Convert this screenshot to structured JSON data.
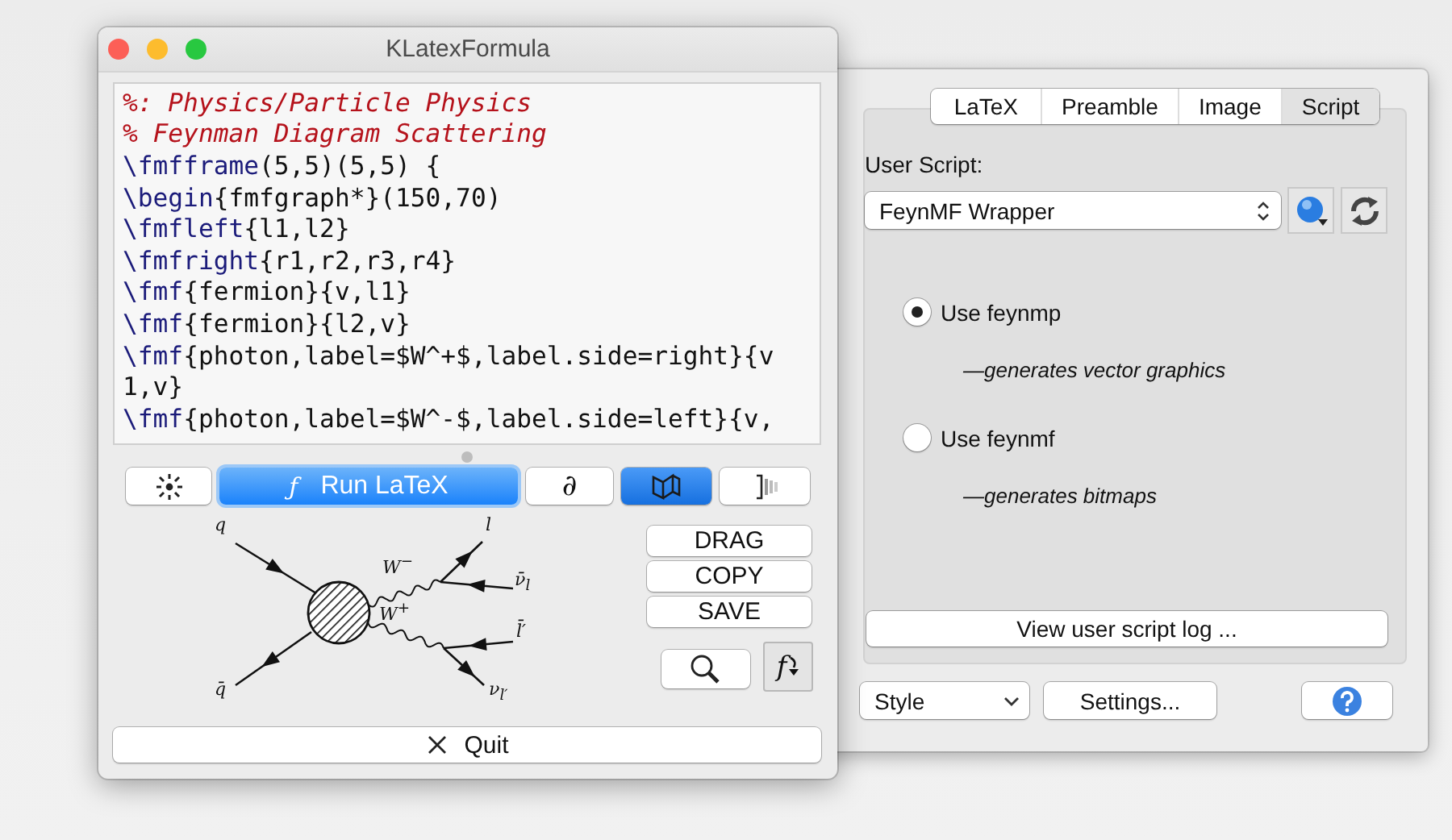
{
  "main_window": {
    "title": "KLatexFormula",
    "editor": {
      "lines": [
        {
          "kind": "comment",
          "text": "%: Physics/Particle Physics"
        },
        {
          "kind": "comment",
          "text": "% Feynman Diagram Scattering"
        },
        {
          "kind": "code",
          "command": "\\fmfframe",
          "rest": "(5,5)(5,5) {"
        },
        {
          "kind": "code",
          "command": "\\begin",
          "rest": "{fmfgraph*}(150,70)"
        },
        {
          "kind": "code",
          "command": "\\fmfleft",
          "rest": "{l1,l2}"
        },
        {
          "kind": "code",
          "command": "\\fmfright",
          "rest": "{r1,r2,r3,r4}"
        },
        {
          "kind": "code",
          "command": "\\fmf",
          "rest": "{fermion}{v,l1}"
        },
        {
          "kind": "code",
          "command": "\\fmf",
          "rest": "{fermion}{l2,v}"
        },
        {
          "kind": "code",
          "command": "\\fmf",
          "rest": "{photon,label=$W^+$,label.side=right}{v"
        },
        {
          "kind": "code",
          "rest": "1,v}"
        },
        {
          "kind": "code",
          "command": "\\fmf",
          "rest": "{photon,label=$W^-$,label.side=left}{v,"
        }
      ]
    },
    "toolbar": [
      {
        "kind": "icon",
        "pressed": false
      },
      {
        "kind": "primary",
        "icon_char": "ƒ",
        "label": "Run LaTeX",
        "pressed": false
      },
      {
        "kind": "glyph",
        "label": "∂",
        "pressed": false
      },
      {
        "kind": "icon",
        "pressed": true
      },
      {
        "kind": "icon",
        "pressed": false
      }
    ],
    "preview": {
      "labels": [
        "q",
        "l",
        "W$^{−}$",
        "ν̄$_{l}$",
        "W$^{+}$",
        "l̄′",
        "q̄",
        "ν$_{l′}$"
      ]
    },
    "actions": [
      "DRAG",
      "COPY",
      "SAVE"
    ],
    "tools": [
      {
        "kind": "icon",
        "pressed": false
      },
      {
        "kind": "glyph",
        "label": "f",
        "pressed": true
      }
    ],
    "quit": {
      "label": "Quit"
    }
  },
  "settings_window": {
    "tabs": [
      {
        "label": "LaTeX",
        "selected": false
      },
      {
        "label": "Preamble",
        "selected": false
      },
      {
        "label": "Image",
        "selected": false
      },
      {
        "label": "Script",
        "selected": true
      }
    ],
    "user_script": {
      "label": "User Script:",
      "value": "FeynMF Wrapper"
    },
    "options": [
      {
        "label": "Use feynmp",
        "description": "—generates vector graphics",
        "selected": true
      },
      {
        "label": "Use feynmf",
        "description": "—generates bitmaps",
        "selected": false
      }
    ],
    "log_button": "View user script log ...",
    "style_select": "Style",
    "settings_button": "Settings..."
  }
}
